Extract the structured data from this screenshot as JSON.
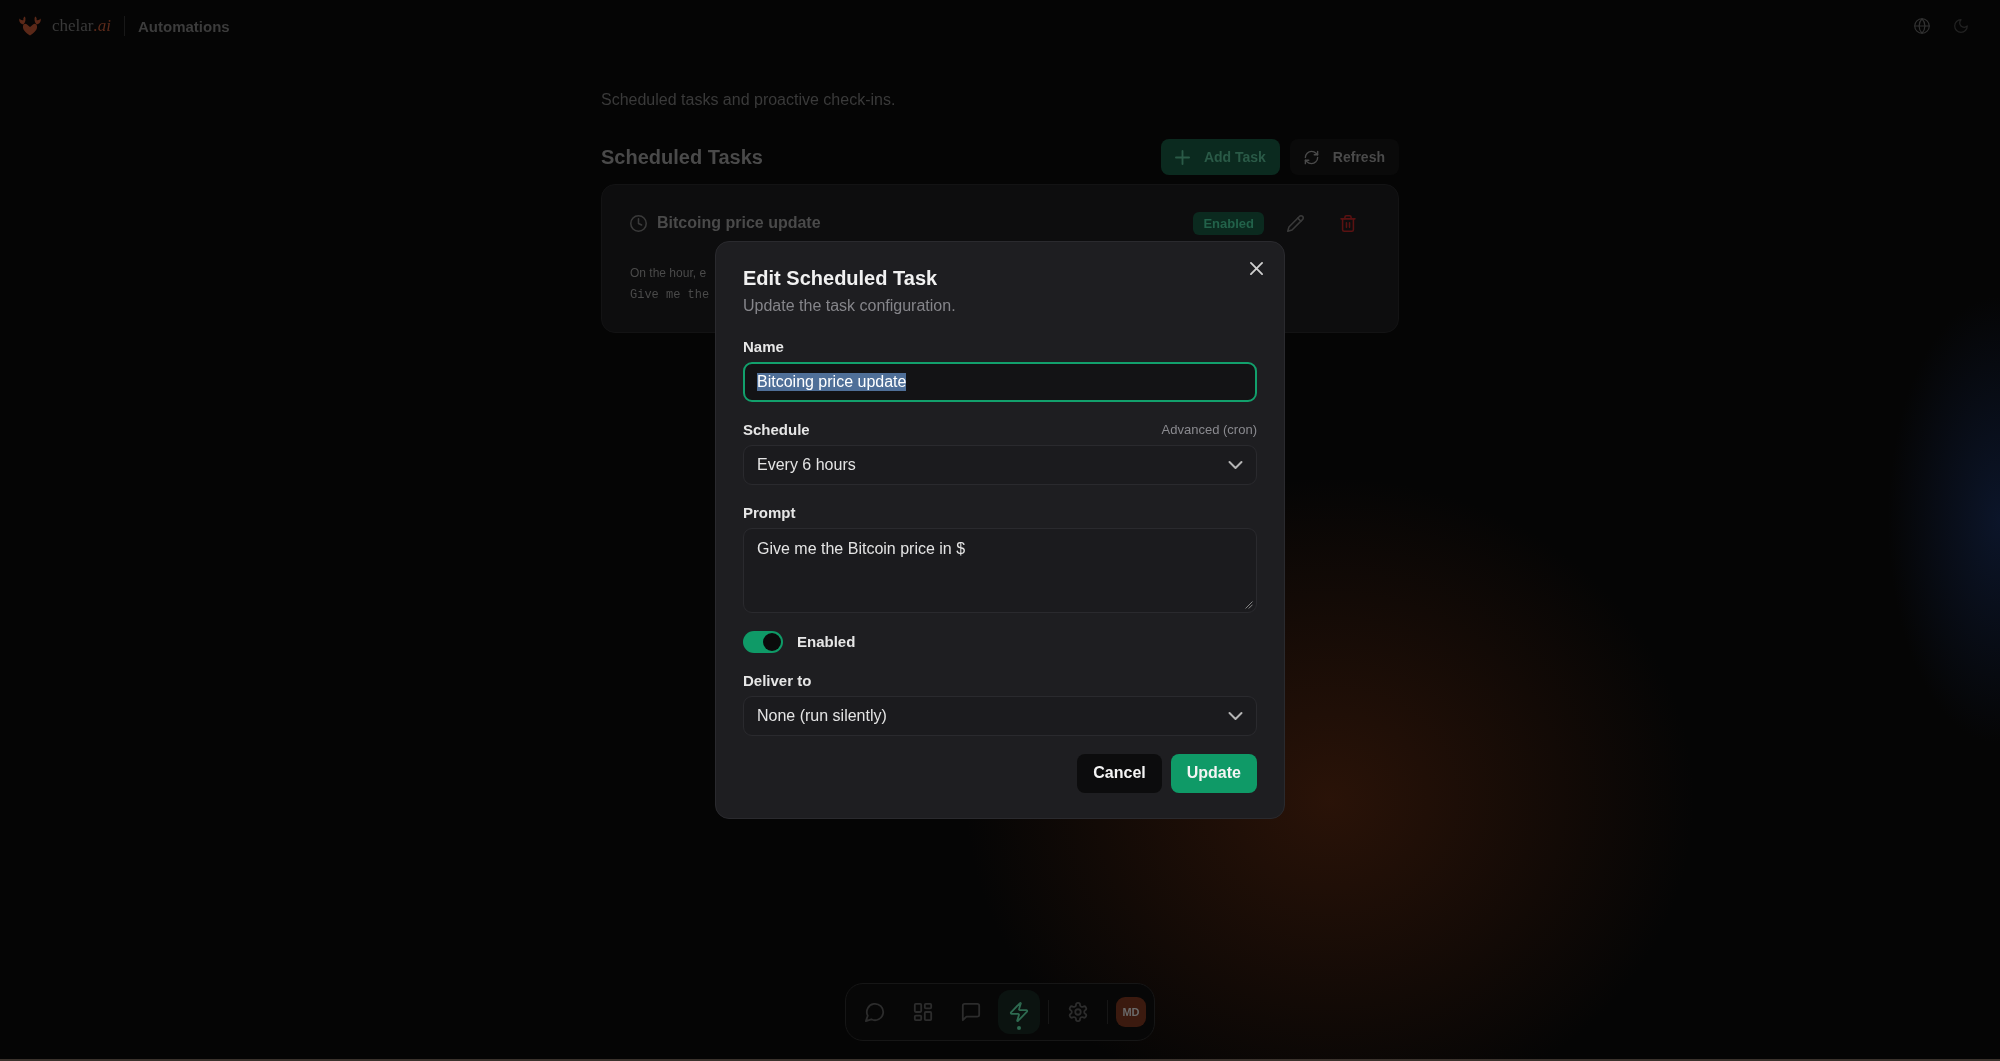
{
  "header": {
    "brand": {
      "name": "chelar",
      "suffix": ".ai"
    },
    "section": "Automations"
  },
  "page": {
    "description": "Scheduled tasks and proactive check-ins.",
    "heading": "Scheduled Tasks",
    "actions": [
      {
        "kind": "primary",
        "label": "Add Task"
      },
      {
        "kind": "secondary",
        "label": "Refresh"
      }
    ],
    "tasks": [
      {
        "name": "Bitcoing price update",
        "enabled": true,
        "status": "Enabled",
        "schedule": "On the hour, e",
        "prompt": "Give me the"
      }
    ]
  },
  "dialog": {
    "title": "Edit Scheduled Task",
    "subtitle": "Update the task configuration.",
    "fields": [
      {
        "kind": "text",
        "label": "Name",
        "value": "Bitcoing price update",
        "focused": true,
        "text_selected": true
      },
      {
        "kind": "select",
        "label": "Schedule",
        "aside": "Advanced (cron)",
        "value": "Every 6 hours",
        "focused": false
      },
      {
        "kind": "textarea",
        "label": "Prompt",
        "value": "Give me the Bitcoin price in $",
        "focused": false
      },
      {
        "kind": "toggle",
        "label": "Enabled",
        "on": true
      },
      {
        "kind": "select",
        "label": "Deliver to",
        "value": "None (run silently)",
        "focused": false
      }
    ],
    "buttons": [
      {
        "kind": "secondary",
        "label": "Cancel"
      },
      {
        "kind": "primary",
        "label": "Update"
      }
    ]
  },
  "dock": {
    "items": [
      {
        "selected": false
      },
      {
        "selected": false
      },
      {
        "selected": false
      },
      {
        "selected": true
      },
      {
        "selected": false
      }
    ],
    "avatar": "MD"
  }
}
